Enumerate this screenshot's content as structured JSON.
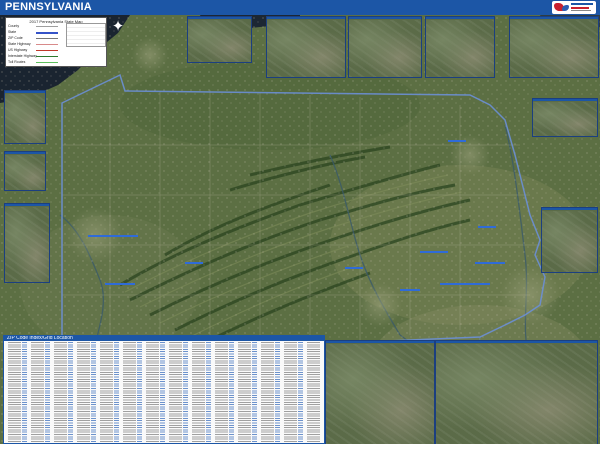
{
  "map": {
    "title": "PENNSYLVANIA",
    "subject": "Pennsylvania satellite wall map with county boundaries, ZIP code index and city insets",
    "legend_title": "2017 Pennsylvania State Map",
    "legend_items": [
      "County",
      "State",
      "ZIP Code",
      "State Highway",
      "US Highway",
      "Interstate Highway",
      "Toll Routes"
    ],
    "zip_index_title": "ZIP Code Index/Grid Location"
  },
  "colors": {
    "header_blue": "#1c56a6",
    "map_green": "#4f6a3a",
    "lake_erie": "#1a2430",
    "ridges": "#2f4a22",
    "state_border": "#6b8fd6"
  },
  "icons": {
    "compass": "compass-rose-icon",
    "logo": "publisher-logo-icon"
  }
}
